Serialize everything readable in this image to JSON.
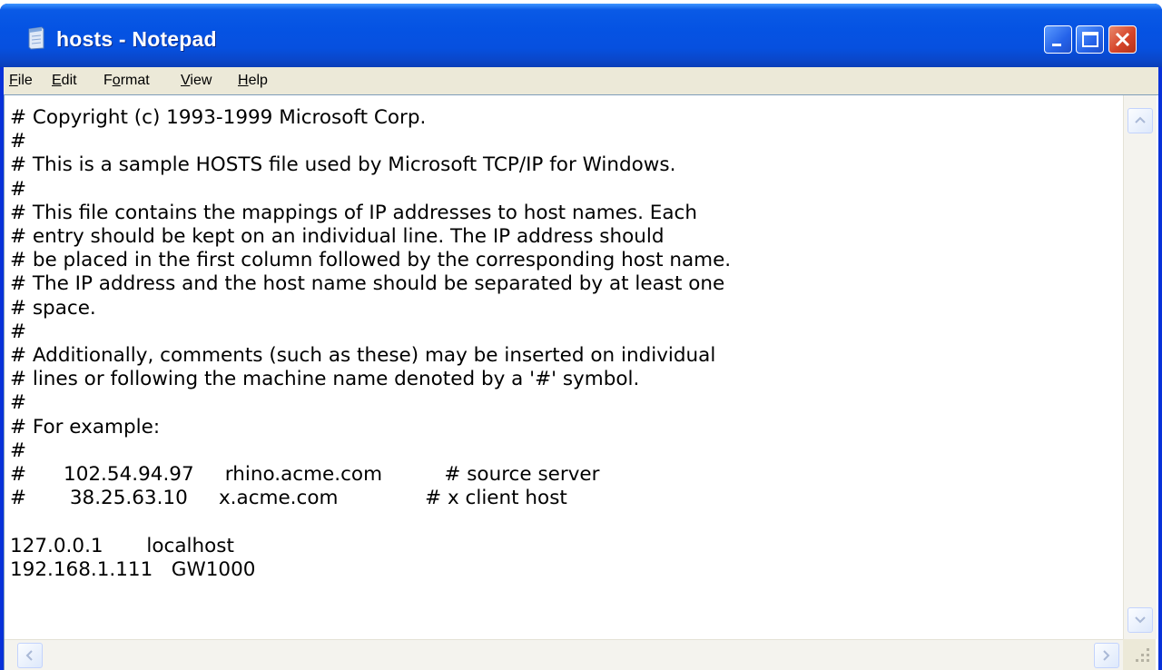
{
  "window": {
    "title": "hosts - Notepad",
    "icon": "notepad-icon",
    "controls": {
      "minimize": "minimize-icon",
      "maximize": "maximize-icon",
      "close": "close-icon"
    },
    "colors": {
      "titlebar": "#0553e3",
      "menubar": "#ece9d8",
      "close_button": "#d6452a"
    }
  },
  "menu": {
    "file": {
      "mnemonic": "F",
      "rest": "ile"
    },
    "edit": {
      "mnemonic": "E",
      "rest": "dit"
    },
    "format": {
      "pre": "F",
      "mnemonic": "o",
      "rest": "rmat"
    },
    "view": {
      "mnemonic": "V",
      "rest": "iew"
    },
    "help": {
      "mnemonic": "H",
      "rest": "elp"
    }
  },
  "document": {
    "content": "# Copyright (c) 1993-1999 Microsoft Corp.\n#\n# This is a sample HOSTS file used by Microsoft TCP/IP for Windows.\n#\n# This file contains the mappings of IP addresses to host names. Each\n# entry should be kept on an individual line. The IP address should\n# be placed in the first column followed by the corresponding host name.\n# The IP address and the host name should be separated by at least one\n# space.\n#\n# Additionally, comments (such as these) may be inserted on individual\n# lines or following the machine name denoted by a '#' symbol.\n#\n# For example:\n#\n#      102.54.94.97     rhino.acme.com          # source server\n#       38.25.63.10     x.acme.com              # x client host\n\n127.0.0.1       localhost\n192.168.1.111   GW1000"
  }
}
